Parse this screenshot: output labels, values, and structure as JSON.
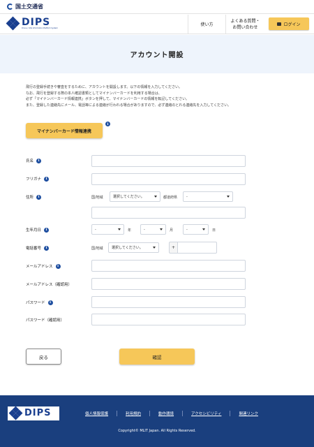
{
  "gov": {
    "name": "国土交通省"
  },
  "header": {
    "logo_word": "DIPS",
    "logo_sub": "Drone / UAS Information Platform System",
    "nav_usage": "使い方",
    "nav_faq_1": "よくある質問・",
    "nav_faq_2": "お問い合わせ",
    "login": "ログイン"
  },
  "page": {
    "title": "アカウント開設"
  },
  "intro": {
    "line1": "飛行の登録手続きや審査をするために、アカウントを開設します。以下の情報を入力してください。",
    "line2": "なお、飛行を登録する際の本人確認書類としてマイナンバーカードを利用する場合は、",
    "line3": "必ず「マイナンバーカード情報連携」ボタンを押して、マイナンバーカードの情報を転記してください。",
    "line4": "また、登録した連絡先にメール、電話等による連絡が行われる場合がありますので、必ず連絡のとれる連絡先を入力してください。"
  },
  "mynumber_button": "マイナンバーカード情報連携",
  "form": {
    "name_label": "氏名",
    "kana_label": "フリガナ",
    "address_label": "住所",
    "country_label": "国/地域",
    "country_value": "選択してください。",
    "pref_label": "都道府県",
    "pref_value": "-",
    "birth_label": "生年月日",
    "year_value": "-",
    "year_unit": "年",
    "month_value": "-",
    "month_unit": "月",
    "day_value": "-",
    "day_unit": "日",
    "phone_label": "電話番号",
    "phone_country_label": "国/地域",
    "phone_country_value": "選択してください。",
    "phone_plus": "+",
    "email_label": "メールアドレス",
    "email_confirm_label": "メールアドレス（確認用）",
    "password_label": "パスワード",
    "password_confirm_label": "パスワード（確認用）"
  },
  "buttons": {
    "back": "戻る",
    "confirm": "確認"
  },
  "footer": {
    "logo_word": "DIPS",
    "links": [
      "個人情報保護",
      "利用規約",
      "動作環境",
      "アクセシビリティ",
      "関連リンク"
    ],
    "copyright": "Copyright© MLIT Japan. All Rights Reserved."
  },
  "colors": {
    "accent": "#f6c759",
    "brand": "#1a3f8f",
    "footer_bg": "#1a3f7e",
    "hero_bg": "#eef4fc"
  }
}
